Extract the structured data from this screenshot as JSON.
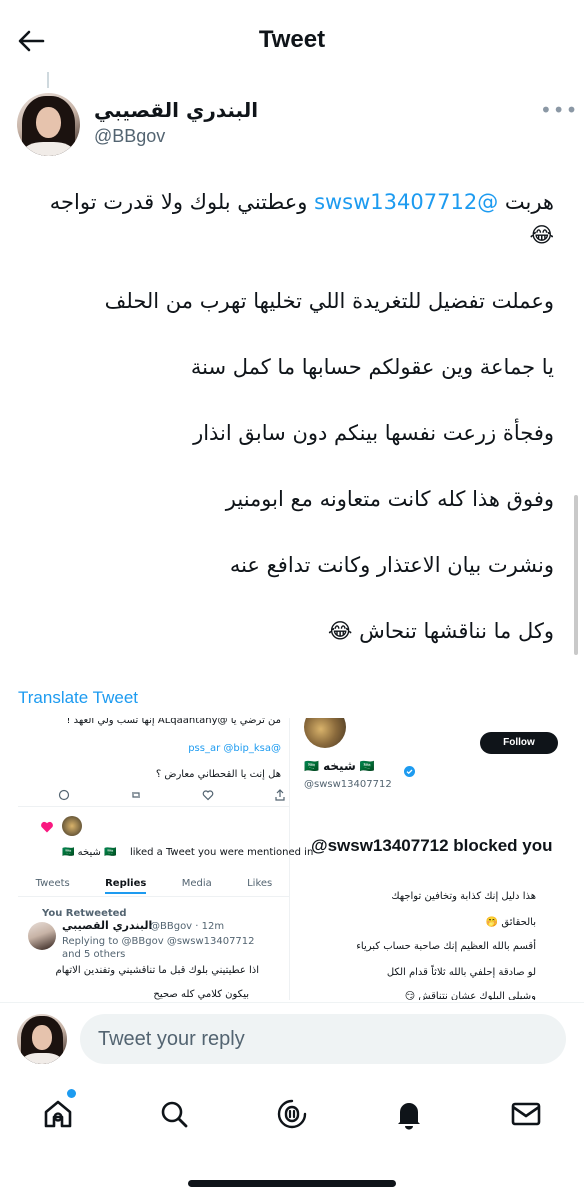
{
  "header": {
    "title": "Tweet",
    "back_icon": "back-arrow-icon"
  },
  "author": {
    "name": "البندري القصيبي",
    "handle": "@BBgov"
  },
  "tweet": {
    "line1_before": "هربت ",
    "line1_mention": "@swsw13407712",
    "line1_after": " وعطتني بلوك ولا قدرت تواجه",
    "line1_emoji": "😂",
    "line2": "وعملت تفضيل للتغريدة اللي تخليها تهرب من الحلف",
    "line3": "يا جماعة وين عقولكم حسابها ما كمل سنة",
    "line4": "وفجأة زرعت نفسها بينكم دون سابق انذار",
    "line5": "وفوق هذا كله كانت متعاونه مع ابومنير",
    "line6": "ونشرت بيان الاعتذار وكانت تدافع عنه",
    "line7": "وكل ما نناقشها تنحاش",
    "line7_emoji": "😂",
    "translate_label": "Translate Tweet"
  },
  "media": {
    "left": {
      "top_text": "من ترضي يا @ALqaahtany إنها تسب ولي العهد !",
      "mentions": "@pss_ar @bip_ksa",
      "question": "هل إنت يا القحطاني معارض ؟",
      "notif_name": "🇸🇦 شيخه 🇸🇦",
      "notif_text": "liked a Tweet you were mentioned in",
      "tabs": [
        "Tweets",
        "Replies",
        "Media",
        "Likes"
      ],
      "retweeted": "You Retweeted",
      "reply_name": "البندري القصيبي",
      "reply_handle_time": "@BBgov · 12m",
      "replying_to": "Replying to @BBgov @swsw13407712 and 5 others",
      "reply_line1": "اذا عطيتيني بلوك قبل ما تناقشيني وتفندين الاتهام",
      "reply_line2": "بيكون كلامي كله صحيح"
    },
    "right": {
      "follow_label": "Follow",
      "profile_name": "🇸🇦 شيخه 🇸🇦",
      "profile_handle": "@swsw13407712",
      "blocked_message": "@swsw13407712 blocked you",
      "line1": "هذا دليل إنك كذابة وتخافين تواجهك",
      "line2": "بالحقائق 🤭",
      "line3": "أقسم بالله العظيم إنك صاحبة حساب كبرياء",
      "line4": "لو صادقة إحلفي بالله ثلاثاً قدام الكل",
      "line5": "وشيلي البلوك عشان نتناقش 😏"
    }
  },
  "reply_bar": {
    "placeholder": "Tweet your reply"
  },
  "nav": {
    "items": [
      "home-icon",
      "search-icon",
      "spaces-icon",
      "notifications-icon",
      "messages-icon"
    ],
    "accent": "#1d9bf0"
  }
}
